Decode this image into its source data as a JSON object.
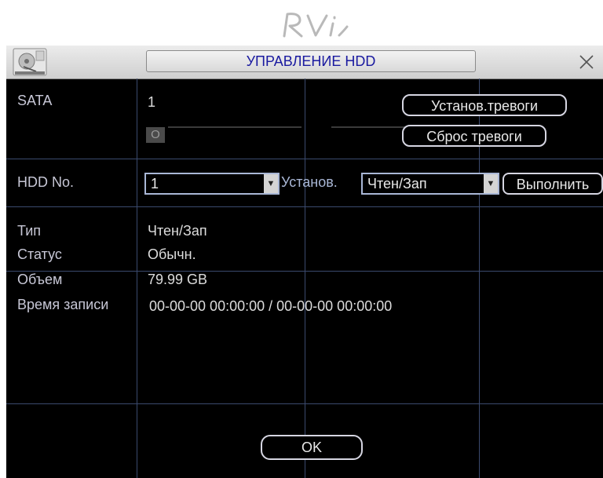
{
  "logo": {
    "text": "RVi"
  },
  "window": {
    "title": "УПРАВЛЕНИЕ HDD",
    "close_icon": "close-icon",
    "header_icon": "hdd-icon"
  },
  "sata": {
    "label": "SATA",
    "value": "1",
    "status_indicator": "O"
  },
  "alarm": {
    "set_label": "Установ.тревоги",
    "reset_label": "Сброс тревоги"
  },
  "hdd_select": {
    "label": "HDD No.",
    "value": "1"
  },
  "set_mode": {
    "label": "Установ.",
    "value": "Чтен/Зап"
  },
  "execute": {
    "label": "Выполнить"
  },
  "info": {
    "type_label": "Тип",
    "type_value": "Чтен/Зап",
    "status_label": "Статус",
    "status_value": "Обычн.",
    "capacity_label": "Объем",
    "capacity_value": "79.99 GB",
    "record_time_label": "Время записи",
    "record_time_value": "00-00-00 00:00:00 / 00-00-00 00:00:00"
  },
  "ok": {
    "label": "OK"
  },
  "colors": {
    "background": "#000000",
    "title_text": "#1a1aa0",
    "grid": "#3b4a6e",
    "text": "#dcdcdc"
  }
}
